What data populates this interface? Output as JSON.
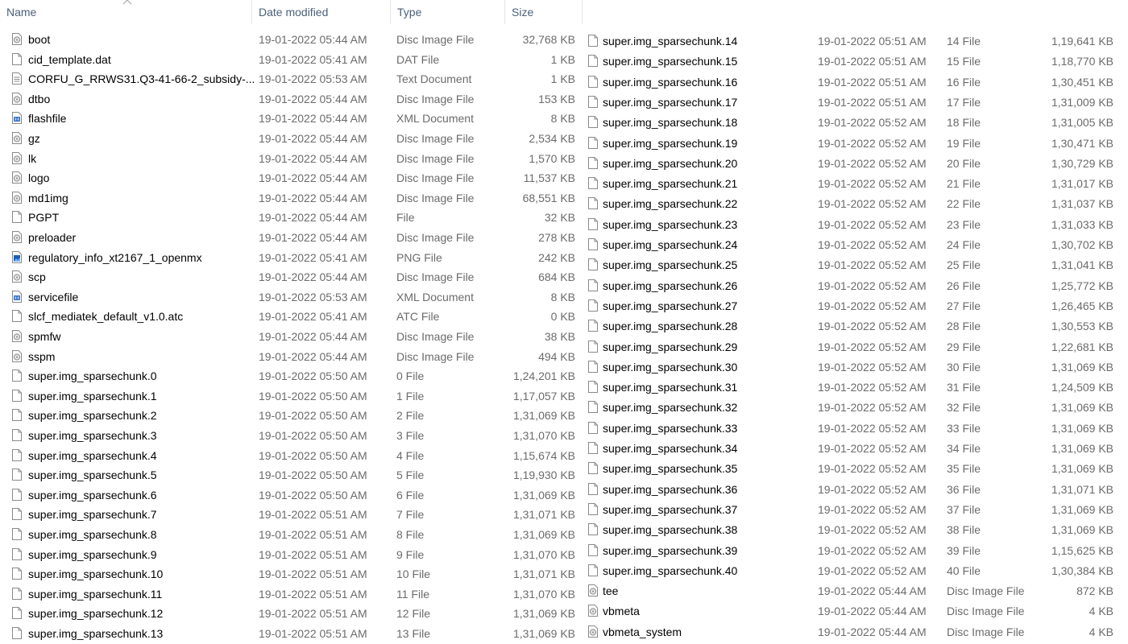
{
  "headers": {
    "name": "Name",
    "date": "Date modified",
    "type": "Type",
    "size": "Size"
  },
  "left_files": [
    {
      "name": "boot",
      "date": "19-01-2022 05:44 AM",
      "type": "Disc Image File",
      "size": "32,768 KB",
      "icon": "disc-image"
    },
    {
      "name": "cid_template.dat",
      "date": "19-01-2022 05:41 AM",
      "type": "DAT File",
      "size": "1 KB",
      "icon": "blank-file"
    },
    {
      "name": "CORFU_G_RRWS31.Q3-41-66-2_subsidy-...",
      "date": "19-01-2022 05:53 AM",
      "type": "Text Document",
      "size": "1 KB",
      "icon": "text-document"
    },
    {
      "name": "dtbo",
      "date": "19-01-2022 05:44 AM",
      "type": "Disc Image File",
      "size": "153 KB",
      "icon": "disc-image"
    },
    {
      "name": "flashfile",
      "date": "19-01-2022 05:44 AM",
      "type": "XML Document",
      "size": "8 KB",
      "icon": "xml-document"
    },
    {
      "name": "gz",
      "date": "19-01-2022 05:44 AM",
      "type": "Disc Image File",
      "size": "2,534 KB",
      "icon": "disc-image"
    },
    {
      "name": "lk",
      "date": "19-01-2022 05:44 AM",
      "type": "Disc Image File",
      "size": "1,570 KB",
      "icon": "disc-image"
    },
    {
      "name": "logo",
      "date": "19-01-2022 05:44 AM",
      "type": "Disc Image File",
      "size": "11,537 KB",
      "icon": "disc-image"
    },
    {
      "name": "md1img",
      "date": "19-01-2022 05:44 AM",
      "type": "Disc Image File",
      "size": "68,551 KB",
      "icon": "disc-image"
    },
    {
      "name": "PGPT",
      "date": "19-01-2022 05:44 AM",
      "type": "File",
      "size": "32 KB",
      "icon": "blank-file"
    },
    {
      "name": "preloader",
      "date": "19-01-2022 05:44 AM",
      "type": "Disc Image File",
      "size": "278 KB",
      "icon": "disc-image"
    },
    {
      "name": "regulatory_info_xt2167_1_openmx",
      "date": "19-01-2022 05:41 AM",
      "type": "PNG File",
      "size": "242 KB",
      "icon": "png-image"
    },
    {
      "name": "scp",
      "date": "19-01-2022 05:44 AM",
      "type": "Disc Image File",
      "size": "684 KB",
      "icon": "disc-image"
    },
    {
      "name": "servicefile",
      "date": "19-01-2022 05:53 AM",
      "type": "XML Document",
      "size": "8 KB",
      "icon": "xml-document"
    },
    {
      "name": "slcf_mediatek_default_v1.0.atc",
      "date": "19-01-2022 05:41 AM",
      "type": "ATC File",
      "size": "0 KB",
      "icon": "blank-file"
    },
    {
      "name": "spmfw",
      "date": "19-01-2022 05:44 AM",
      "type": "Disc Image File",
      "size": "38 KB",
      "icon": "disc-image"
    },
    {
      "name": "sspm",
      "date": "19-01-2022 05:44 AM",
      "type": "Disc Image File",
      "size": "494 KB",
      "icon": "disc-image"
    },
    {
      "name": "super.img_sparsechunk.0",
      "date": "19-01-2022 05:50 AM",
      "type": "0 File",
      "size": "1,24,201 KB",
      "icon": "blank-file"
    },
    {
      "name": "super.img_sparsechunk.1",
      "date": "19-01-2022 05:50 AM",
      "type": "1 File",
      "size": "1,17,057 KB",
      "icon": "blank-file"
    },
    {
      "name": "super.img_sparsechunk.2",
      "date": "19-01-2022 05:50 AM",
      "type": "2 File",
      "size": "1,31,069 KB",
      "icon": "blank-file"
    },
    {
      "name": "super.img_sparsechunk.3",
      "date": "19-01-2022 05:50 AM",
      "type": "3 File",
      "size": "1,31,070 KB",
      "icon": "blank-file"
    },
    {
      "name": "super.img_sparsechunk.4",
      "date": "19-01-2022 05:50 AM",
      "type": "4 File",
      "size": "1,15,674 KB",
      "icon": "blank-file"
    },
    {
      "name": "super.img_sparsechunk.5",
      "date": "19-01-2022 05:50 AM",
      "type": "5 File",
      "size": "1,19,930 KB",
      "icon": "blank-file"
    },
    {
      "name": "super.img_sparsechunk.6",
      "date": "19-01-2022 05:50 AM",
      "type": "6 File",
      "size": "1,31,069 KB",
      "icon": "blank-file"
    },
    {
      "name": "super.img_sparsechunk.7",
      "date": "19-01-2022 05:51 AM",
      "type": "7 File",
      "size": "1,31,071 KB",
      "icon": "blank-file"
    },
    {
      "name": "super.img_sparsechunk.8",
      "date": "19-01-2022 05:51 AM",
      "type": "8 File",
      "size": "1,31,069 KB",
      "icon": "blank-file"
    },
    {
      "name": "super.img_sparsechunk.9",
      "date": "19-01-2022 05:51 AM",
      "type": "9 File",
      "size": "1,31,070 KB",
      "icon": "blank-file"
    },
    {
      "name": "super.img_sparsechunk.10",
      "date": "19-01-2022 05:51 AM",
      "type": "10 File",
      "size": "1,31,071 KB",
      "icon": "blank-file"
    },
    {
      "name": "super.img_sparsechunk.11",
      "date": "19-01-2022 05:51 AM",
      "type": "11 File",
      "size": "1,31,070 KB",
      "icon": "blank-file"
    },
    {
      "name": "super.img_sparsechunk.12",
      "date": "19-01-2022 05:51 AM",
      "type": "12 File",
      "size": "1,31,069 KB",
      "icon": "blank-file"
    },
    {
      "name": "super.img_sparsechunk.13",
      "date": "19-01-2022 05:51 AM",
      "type": "13 File",
      "size": "1,31,069 KB",
      "icon": "blank-file"
    }
  ],
  "right_files": [
    {
      "name": "super.img_sparsechunk.14",
      "date": "19-01-2022 05:51 AM",
      "type": "14 File",
      "size": "1,19,641 KB",
      "icon": "blank-file"
    },
    {
      "name": "super.img_sparsechunk.15",
      "date": "19-01-2022 05:51 AM",
      "type": "15 File",
      "size": "1,18,770 KB",
      "icon": "blank-file"
    },
    {
      "name": "super.img_sparsechunk.16",
      "date": "19-01-2022 05:51 AM",
      "type": "16 File",
      "size": "1,30,451 KB",
      "icon": "blank-file"
    },
    {
      "name": "super.img_sparsechunk.17",
      "date": "19-01-2022 05:51 AM",
      "type": "17 File",
      "size": "1,31,009 KB",
      "icon": "blank-file"
    },
    {
      "name": "super.img_sparsechunk.18",
      "date": "19-01-2022 05:52 AM",
      "type": "18 File",
      "size": "1,31,005 KB",
      "icon": "blank-file"
    },
    {
      "name": "super.img_sparsechunk.19",
      "date": "19-01-2022 05:52 AM",
      "type": "19 File",
      "size": "1,30,471 KB",
      "icon": "blank-file"
    },
    {
      "name": "super.img_sparsechunk.20",
      "date": "19-01-2022 05:52 AM",
      "type": "20 File",
      "size": "1,30,729 KB",
      "icon": "blank-file"
    },
    {
      "name": "super.img_sparsechunk.21",
      "date": "19-01-2022 05:52 AM",
      "type": "21 File",
      "size": "1,31,017 KB",
      "icon": "blank-file"
    },
    {
      "name": "super.img_sparsechunk.22",
      "date": "19-01-2022 05:52 AM",
      "type": "22 File",
      "size": "1,31,037 KB",
      "icon": "blank-file"
    },
    {
      "name": "super.img_sparsechunk.23",
      "date": "19-01-2022 05:52 AM",
      "type": "23 File",
      "size": "1,31,033 KB",
      "icon": "blank-file"
    },
    {
      "name": "super.img_sparsechunk.24",
      "date": "19-01-2022 05:52 AM",
      "type": "24 File",
      "size": "1,30,702 KB",
      "icon": "blank-file"
    },
    {
      "name": "super.img_sparsechunk.25",
      "date": "19-01-2022 05:52 AM",
      "type": "25 File",
      "size": "1,31,041 KB",
      "icon": "blank-file"
    },
    {
      "name": "super.img_sparsechunk.26",
      "date": "19-01-2022 05:52 AM",
      "type": "26 File",
      "size": "1,25,772 KB",
      "icon": "blank-file"
    },
    {
      "name": "super.img_sparsechunk.27",
      "date": "19-01-2022 05:52 AM",
      "type": "27 File",
      "size": "1,26,465 KB",
      "icon": "blank-file"
    },
    {
      "name": "super.img_sparsechunk.28",
      "date": "19-01-2022 05:52 AM",
      "type": "28 File",
      "size": "1,30,553 KB",
      "icon": "blank-file"
    },
    {
      "name": "super.img_sparsechunk.29",
      "date": "19-01-2022 05:52 AM",
      "type": "29 File",
      "size": "1,22,681 KB",
      "icon": "blank-file"
    },
    {
      "name": "super.img_sparsechunk.30",
      "date": "19-01-2022 05:52 AM",
      "type": "30 File",
      "size": "1,31,069 KB",
      "icon": "blank-file"
    },
    {
      "name": "super.img_sparsechunk.31",
      "date": "19-01-2022 05:52 AM",
      "type": "31 File",
      "size": "1,24,509 KB",
      "icon": "blank-file"
    },
    {
      "name": "super.img_sparsechunk.32",
      "date": "19-01-2022 05:52 AM",
      "type": "32 File",
      "size": "1,31,069 KB",
      "icon": "blank-file"
    },
    {
      "name": "super.img_sparsechunk.33",
      "date": "19-01-2022 05:52 AM",
      "type": "33 File",
      "size": "1,31,069 KB",
      "icon": "blank-file"
    },
    {
      "name": "super.img_sparsechunk.34",
      "date": "19-01-2022 05:52 AM",
      "type": "34 File",
      "size": "1,31,069 KB",
      "icon": "blank-file"
    },
    {
      "name": "super.img_sparsechunk.35",
      "date": "19-01-2022 05:52 AM",
      "type": "35 File",
      "size": "1,31,069 KB",
      "icon": "blank-file"
    },
    {
      "name": "super.img_sparsechunk.36",
      "date": "19-01-2022 05:52 AM",
      "type": "36 File",
      "size": "1,31,071 KB",
      "icon": "blank-file"
    },
    {
      "name": "super.img_sparsechunk.37",
      "date": "19-01-2022 05:52 AM",
      "type": "37 File",
      "size": "1,31,069 KB",
      "icon": "blank-file"
    },
    {
      "name": "super.img_sparsechunk.38",
      "date": "19-01-2022 05:52 AM",
      "type": "38 File",
      "size": "1,31,069 KB",
      "icon": "blank-file"
    },
    {
      "name": "super.img_sparsechunk.39",
      "date": "19-01-2022 05:52 AM",
      "type": "39 File",
      "size": "1,15,625 KB",
      "icon": "blank-file"
    },
    {
      "name": "super.img_sparsechunk.40",
      "date": "19-01-2022 05:52 AM",
      "type": "40 File",
      "size": "1,30,384 KB",
      "icon": "blank-file"
    },
    {
      "name": "tee",
      "date": "19-01-2022 05:44 AM",
      "type": "Disc Image File",
      "size": "872 KB",
      "icon": "disc-image"
    },
    {
      "name": "vbmeta",
      "date": "19-01-2022 05:44 AM",
      "type": "Disc Image File",
      "size": "4 KB",
      "icon": "disc-image"
    },
    {
      "name": "vbmeta_system",
      "date": "19-01-2022 05:44 AM",
      "type": "Disc Image File",
      "size": "4 KB",
      "icon": "disc-image"
    }
  ]
}
